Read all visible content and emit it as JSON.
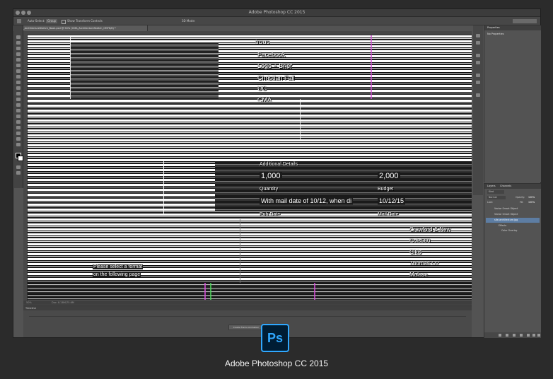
{
  "window": {
    "title": "Adobe Photoshop CC 2015"
  },
  "options_bar": {
    "auto_select_label": "Auto-Select:",
    "auto_select_value": "Group",
    "transform_label": "Show Transform Controls",
    "mode_3d": "3D Mode:"
  },
  "document_tab": {
    "label": "CMA_ArchitectureSketch_Book.psd @ 50% (CMA_ArchitectureSketch_CMYK/8) *"
  },
  "canvas_text": {
    "group_title": "Additional Details",
    "quantity_value": "1,000",
    "budget_value": "2,000",
    "quantity_label": "Quantity",
    "budget_label": "Budget",
    "note_text": "With mail date of 10/12, when di",
    "date_value": "10/12/15",
    "pub_date_label": "Pub Date",
    "mail_date_label": "Mail Date",
    "list_1": "trous",
    "list_2": "Facebook",
    "list_3": "Logo + Brief",
    "list_4": "Christian Fall",
    "list_5": "UC",
    "list_6": "CMA",
    "right_1": "Crawford & New",
    "right_2": "Cols580",
    "right_3": "Cikis",
    "right_4": "Thomas O2",
    "right_5": "Mulase",
    "format_line_1": "Please select a format",
    "format_line_2": "on the following page"
  },
  "status_bar": {
    "zoom": "50%",
    "doc_size": "Doc: 8.28M/75.6M"
  },
  "timeline": {
    "title": "Timeline",
    "create_button": "Create Frame Animation"
  },
  "properties_panel": {
    "tab": "Properties",
    "subtitle": "No Properties"
  },
  "layers_panel": {
    "tabs": [
      "Layers",
      "Channels"
    ],
    "filter": "Kind",
    "blend_mode": "Normal",
    "opacity_label": "Opacity:",
    "opacity_value": "100%",
    "lock_label": "Lock:",
    "fill_label": "Fill:",
    "fill_value": "100%",
    "layers": [
      {
        "name": "Vector Smart Object",
        "selected": false
      },
      {
        "name": "Vector Smart Object",
        "selected": false
      },
      {
        "name": "site-architecture.jpg",
        "selected": true
      },
      {
        "name": "Effects",
        "selected": false
      },
      {
        "name": "Color Overlay",
        "selected": false
      }
    ]
  },
  "app_caption": "Adobe Photoshop CC 2015",
  "logo_text": "Ps",
  "colors": {
    "accent": "#30a8ff",
    "selection": "#5d7da3",
    "glitch_magenta": "#d34cd6",
    "glitch_green": "#4cd65a"
  }
}
